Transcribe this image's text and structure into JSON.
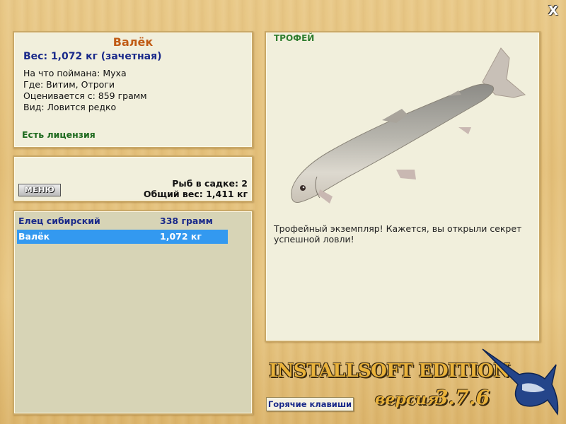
{
  "window": {
    "close_label": "X"
  },
  "fish_info": {
    "name": "Валёк",
    "weight_line": "Вес: 1,072 кг (зачетная)",
    "caught_on": "На что поймана: Муха",
    "location": "Где: Витим, Отроги",
    "counted_from": "Оценивается с: 859 грамм",
    "species_status": "Вид: Ловится редко",
    "license": "Есть лицензия"
  },
  "net": {
    "menu_label": "МЕНЮ",
    "fish_count": "Рыб в садке: 2",
    "total_weight": "Общий вес: 1,411 кг"
  },
  "catch_list": [
    {
      "name": "Елец сибирский",
      "weight": "338 грамм",
      "selected": false
    },
    {
      "name": "Валёк",
      "weight": "1,072 кг",
      "selected": true
    }
  ],
  "trophy": {
    "label": "ТРОФЕЙ",
    "message": "Трофейный экземпляр! Кажется, вы открыли секрет успешной ловли!"
  },
  "footer": {
    "hotkeys_label": "Горячие клавиши",
    "edition": "INSTALLSOFT EDITION",
    "version_label": "версия",
    "version_number": "3.7.6"
  },
  "colors": {
    "title": "#c05a14",
    "weight": "#1a2a8a",
    "license": "#1e6a1e",
    "selection": "#3399f0",
    "trophy_label": "#2f7d2f"
  },
  "icons": {
    "fish": "fish-image",
    "marlin": "marlin-logo",
    "close": "close-icon"
  }
}
